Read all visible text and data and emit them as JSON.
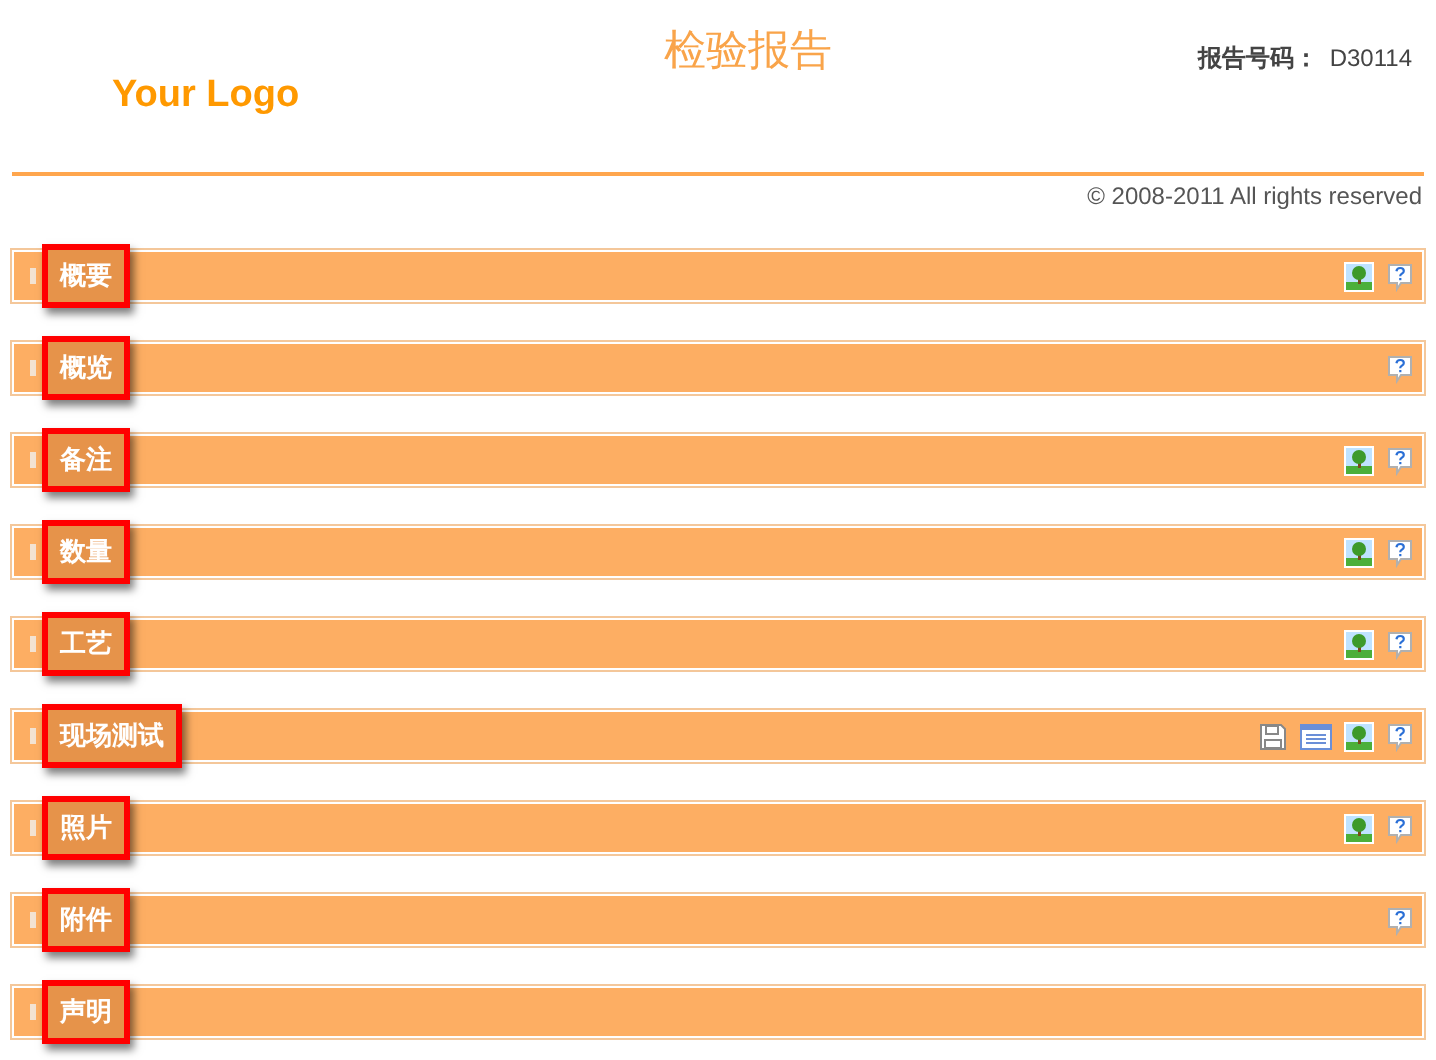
{
  "header": {
    "logo": "Your Logo",
    "title": "检验报告",
    "report_label": "报告号码：",
    "report_number": "D30114"
  },
  "copyright": "© 2008-2011 All rights reserved",
  "sections": [
    {
      "label": "概要",
      "tools": [
        {
          "kind": "picture"
        },
        {
          "kind": "help"
        }
      ]
    },
    {
      "label": "概览",
      "tools": [
        {
          "kind": "help"
        }
      ]
    },
    {
      "label": "备注",
      "tools": [
        {
          "kind": "picture"
        },
        {
          "kind": "help"
        }
      ]
    },
    {
      "label": "数量",
      "tools": [
        {
          "kind": "picture"
        },
        {
          "kind": "help"
        }
      ]
    },
    {
      "label": "工艺",
      "tools": [
        {
          "kind": "picture"
        },
        {
          "kind": "help"
        }
      ]
    },
    {
      "label": "现场测试",
      "tools": [
        {
          "kind": "save"
        },
        {
          "kind": "list"
        },
        {
          "kind": "picture"
        },
        {
          "kind": "help"
        }
      ]
    },
    {
      "label": "照片",
      "tools": [
        {
          "kind": "picture"
        },
        {
          "kind": "help"
        }
      ]
    },
    {
      "label": "附件",
      "tools": [
        {
          "kind": "help"
        }
      ]
    },
    {
      "label": "声明"
    }
  ]
}
